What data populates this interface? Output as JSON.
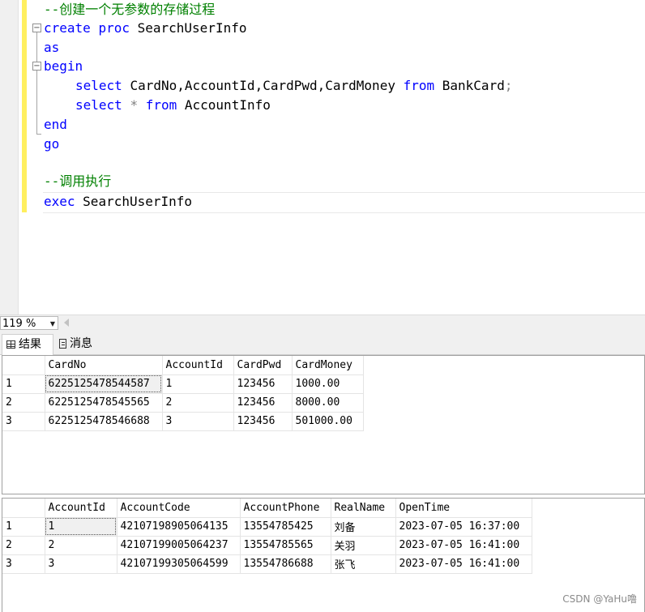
{
  "editor": {
    "lines": [
      {
        "comment": "--创建一个无参数的存储过程"
      },
      {
        "kw1": "create",
        "kw2": "proc",
        "text": "SearchUserInfo"
      },
      {
        "kw1": "as"
      },
      {
        "kw1": "begin"
      },
      {
        "kw1": "select",
        "text": "CardNo,AccountId,CardPwd,CardMoney",
        "kw2": "from",
        "text2": "BankCard",
        "punct": ";"
      },
      {
        "kw1": "select",
        "op": "*",
        "kw2": "from",
        "text": "AccountInfo"
      },
      {
        "kw1": "end"
      },
      {
        "kw1": "go"
      },
      {
        "comment": "--调用执行"
      },
      {
        "kw1": "exec",
        "text": "SearchUserInfo"
      }
    ]
  },
  "zoom": {
    "value": "119 %",
    "arrow": "▼"
  },
  "tabs": [
    {
      "label": "结果",
      "icon": "grid-icon"
    },
    {
      "label": "消息",
      "icon": "message-icon"
    }
  ],
  "results": [
    {
      "columns": [
        "CardNo",
        "AccountId",
        "CardPwd",
        "CardMoney"
      ],
      "rows": [
        {
          "num": "1",
          "cells": [
            "6225125478544587",
            "1",
            "123456",
            "1000.00"
          ]
        },
        {
          "num": "2",
          "cells": [
            "6225125478545565",
            "2",
            "123456",
            "8000.00"
          ]
        },
        {
          "num": "3",
          "cells": [
            "6225125478546688",
            "3",
            "123456",
            "501000.00"
          ]
        }
      ]
    },
    {
      "columns": [
        "AccountId",
        "AccountCode",
        "AccountPhone",
        "RealName",
        "OpenTime"
      ],
      "rows": [
        {
          "num": "1",
          "cells": [
            "1",
            "42107198905064135",
            "13554785425",
            "刘备",
            "2023-07-05 16:37:00"
          ]
        },
        {
          "num": "2",
          "cells": [
            "2",
            "42107199005064237",
            "13554785565",
            "关羽",
            "2023-07-05 16:41:00"
          ]
        },
        {
          "num": "3",
          "cells": [
            "3",
            "42107199305064599",
            "13554786688",
            "张飞",
            "2023-07-05 16:41:00"
          ]
        }
      ]
    }
  ],
  "watermark": "CSDN @YaHu噜",
  "colors": {
    "keyword": "#0000ff",
    "comment": "#008000",
    "change_bar": "#ffef5e"
  }
}
